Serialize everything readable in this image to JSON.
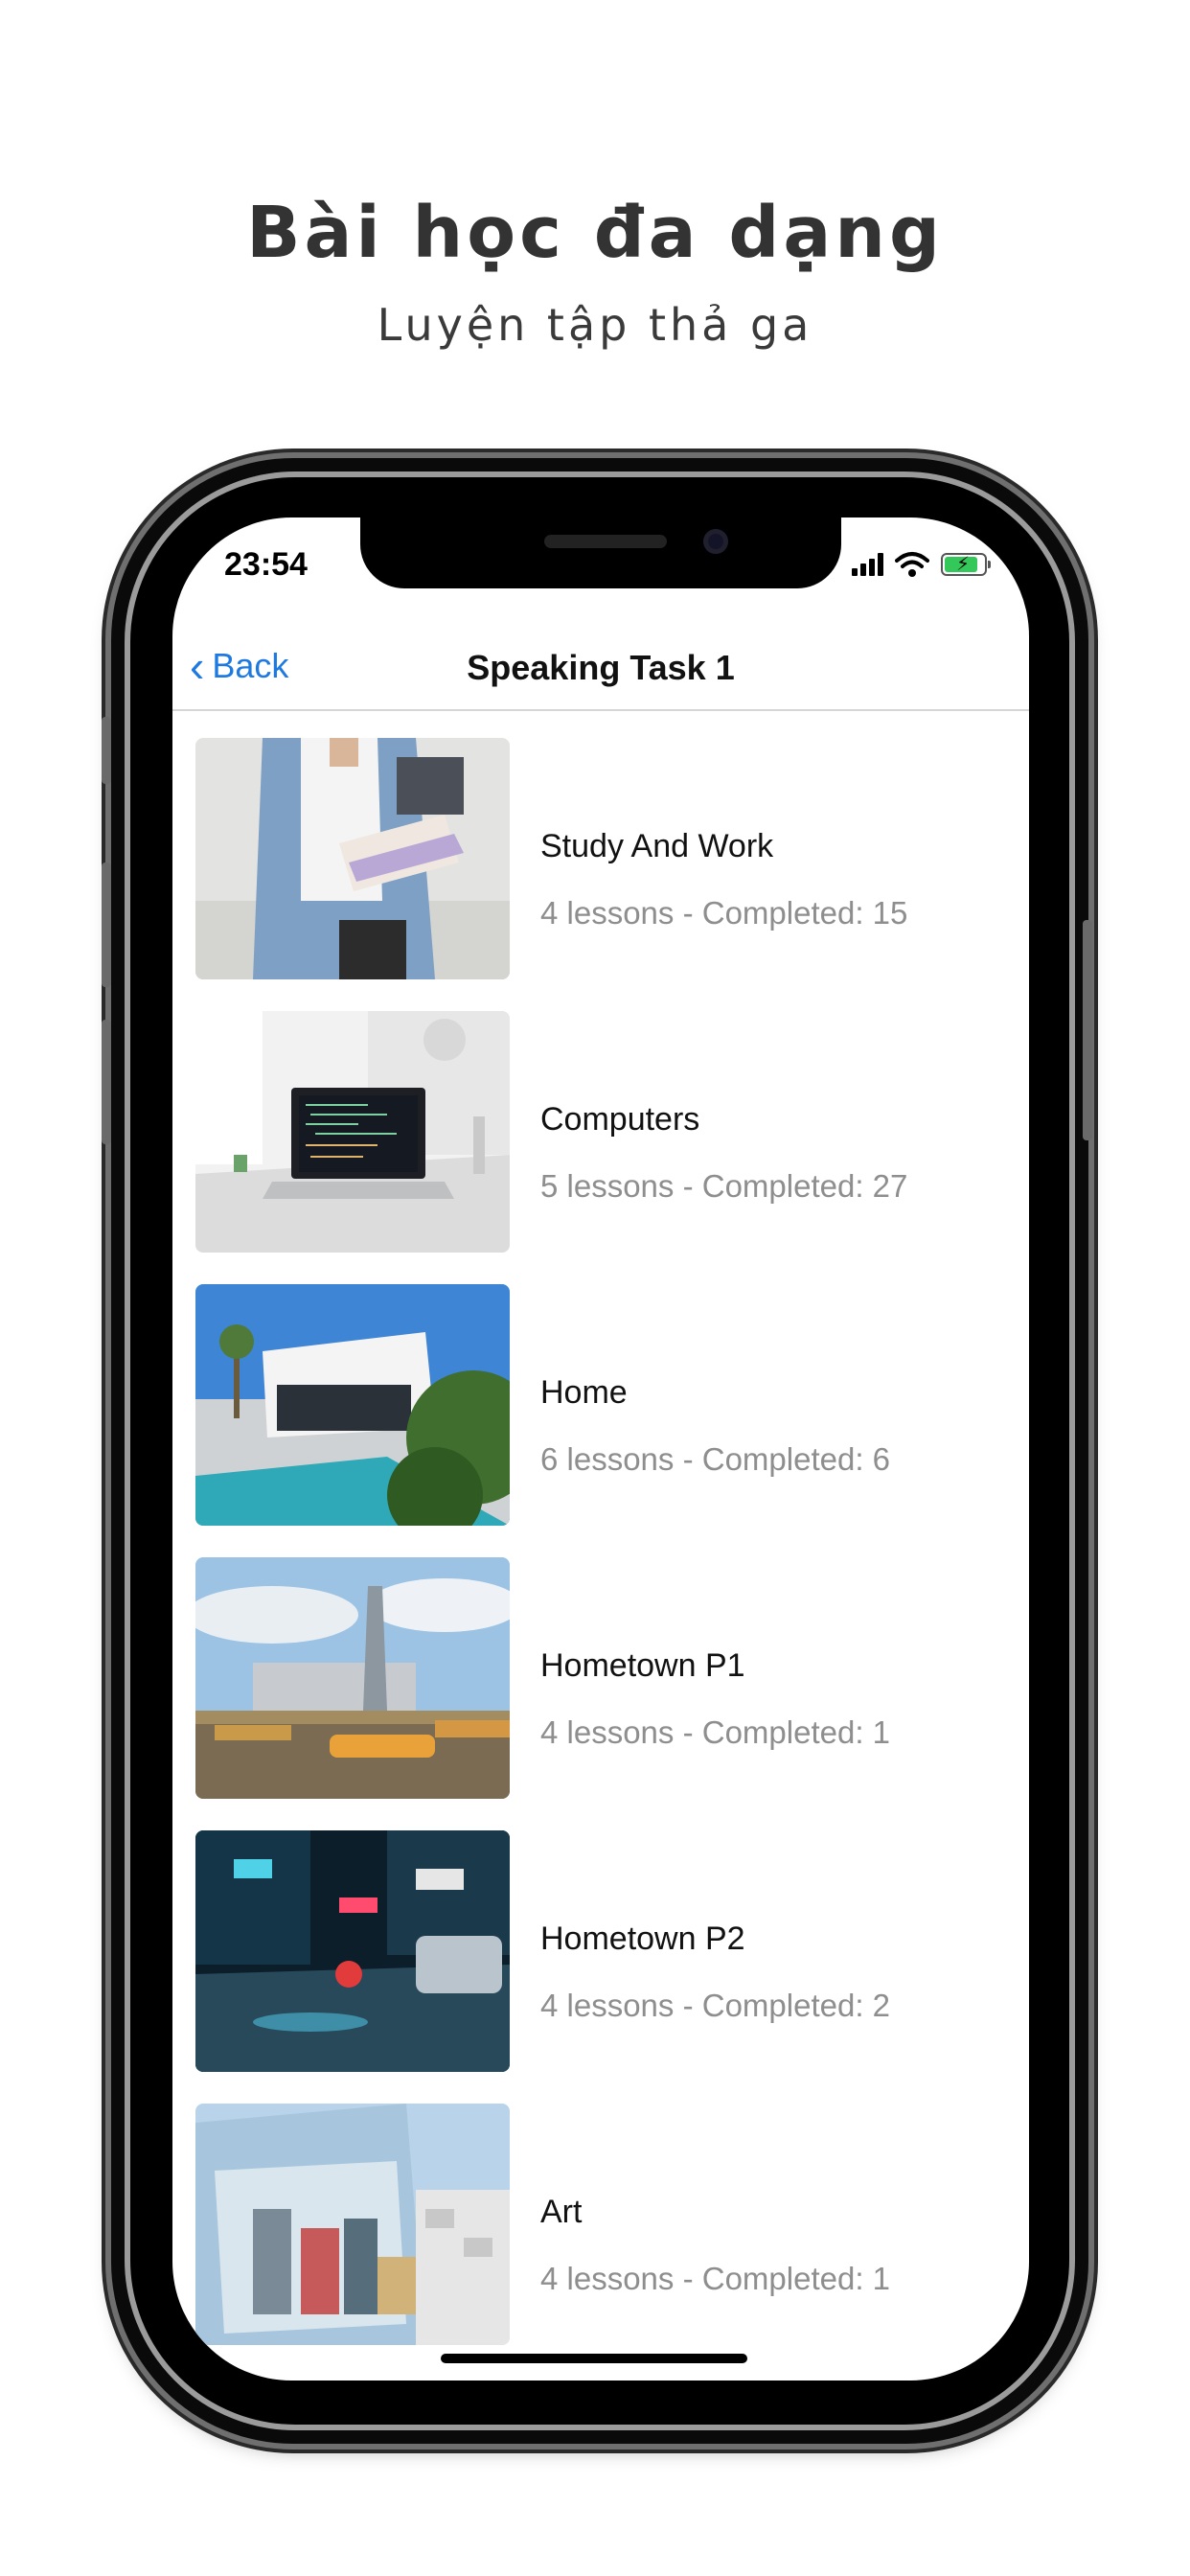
{
  "promo": {
    "headline": "Bài học đa dạng",
    "subline": "Luyện tập thả ga"
  },
  "status_bar": {
    "time": "23:54"
  },
  "nav": {
    "back_label": "Back",
    "title": "Speaking Task 1"
  },
  "topics": [
    {
      "title": "Study And Work",
      "subtitle": "4 lessons - Completed: 15",
      "image": "student-with-books-photo"
    },
    {
      "title": "Computers",
      "subtitle": "5 lessons - Completed: 27",
      "image": "laptop-on-desk-photo"
    },
    {
      "title": "Home",
      "subtitle": "6 lessons - Completed: 6",
      "image": "modern-house-pool-photo"
    },
    {
      "title": "Hometown P1",
      "subtitle": "4 lessons - Completed: 1",
      "image": "city-skyline-river-photo"
    },
    {
      "title": "Hometown P2",
      "subtitle": "4 lessons - Completed: 2",
      "image": "night-street-neon-photo"
    },
    {
      "title": "Art",
      "subtitle": "4 lessons - Completed: 1",
      "image": "street-mural-photo"
    }
  ],
  "colors": {
    "accent": "#1e7ae0",
    "battery": "#34c759",
    "subtitle_text": "#8e8e8e"
  }
}
